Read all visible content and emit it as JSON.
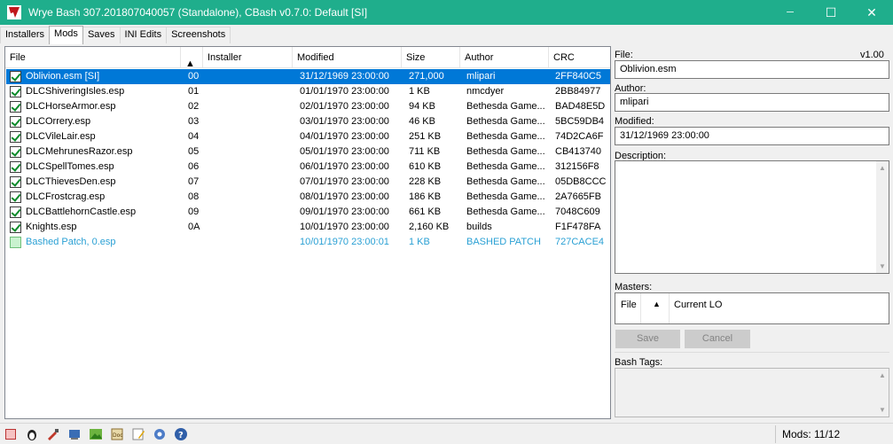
{
  "window": {
    "title": "Wrye Bash 307.201807040057 (Standalone), CBash v0.7.0: Default [SI]",
    "minimize_glyph": "─",
    "maximize_glyph": "☐",
    "close_glyph": "✕",
    "accent_color": "#1fae8c"
  },
  "tabs": [
    {
      "label": "Installers"
    },
    {
      "label": "Mods"
    },
    {
      "label": "Saves"
    },
    {
      "label": "INI Edits"
    },
    {
      "label": "Screenshots"
    }
  ],
  "mods_list": {
    "columns": [
      "File",
      "",
      "Installer",
      "Modified",
      "Size",
      "Author",
      "CRC"
    ],
    "sort_arrow": "▲",
    "rows": [
      {
        "file": "Oblivion.esm [SI]",
        "order": "00",
        "installer": "",
        "modified": "31/12/1969 23:00:00",
        "size": "271,000",
        "author": "mlipari",
        "crc": "2FF840C5",
        "state": "selected"
      },
      {
        "file": "DLCShiveringIsles.esp",
        "order": "01",
        "installer": "",
        "modified": "01/01/1970 23:00:00",
        "size": "1 KB",
        "author": "nmcdyer",
        "crc": "2BB84977",
        "state": "active"
      },
      {
        "file": "DLCHorseArmor.esp",
        "order": "02",
        "installer": "",
        "modified": "02/01/1970 23:00:00",
        "size": "94 KB",
        "author": "Bethesda Game...",
        "crc": "BAD48E5D",
        "state": "active"
      },
      {
        "file": "DLCOrrery.esp",
        "order": "03",
        "installer": "",
        "modified": "03/01/1970 23:00:00",
        "size": "46 KB",
        "author": "Bethesda Game...",
        "crc": "5BC59DB4",
        "state": "active"
      },
      {
        "file": "DLCVileLair.esp",
        "order": "04",
        "installer": "",
        "modified": "04/01/1970 23:00:00",
        "size": "251 KB",
        "author": "Bethesda Game...",
        "crc": "74D2CA6F",
        "state": "active"
      },
      {
        "file": "DLCMehrunesRazor.esp",
        "order": "05",
        "installer": "",
        "modified": "05/01/1970 23:00:00",
        "size": "711 KB",
        "author": "Bethesda Game...",
        "crc": "CB413740",
        "state": "active"
      },
      {
        "file": "DLCSpellTomes.esp",
        "order": "06",
        "installer": "",
        "modified": "06/01/1970 23:00:00",
        "size": "610 KB",
        "author": "Bethesda Game...",
        "crc": "312156F8",
        "state": "active"
      },
      {
        "file": "DLCThievesDen.esp",
        "order": "07",
        "installer": "",
        "modified": "07/01/1970 23:00:00",
        "size": "228 KB",
        "author": "Bethesda Game...",
        "crc": "05DB8CCC",
        "state": "active"
      },
      {
        "file": "DLCFrostcrag.esp",
        "order": "08",
        "installer": "",
        "modified": "08/01/1970 23:00:00",
        "size": "186 KB",
        "author": "Bethesda Game...",
        "crc": "2A7665FB",
        "state": "active"
      },
      {
        "file": "DLCBattlehornCastle.esp",
        "order": "09",
        "installer": "",
        "modified": "09/01/1970 23:00:00",
        "size": "661 KB",
        "author": "Bethesda Game...",
        "crc": "7048C609",
        "state": "active"
      },
      {
        "file": "Knights.esp",
        "order": "0A",
        "installer": "",
        "modified": "10/01/1970 23:00:00",
        "size": "2,160 KB",
        "author": "builds",
        "crc": "F1F478FA",
        "state": "active"
      },
      {
        "file": "Bashed Patch, 0.esp",
        "order": "",
        "installer": "",
        "modified": "10/01/1970 23:00:01",
        "size": "1 KB",
        "author": "BASHED PATCH",
        "crc": "727CACE4",
        "state": "bashed"
      }
    ]
  },
  "details": {
    "file_label": "File:",
    "version": "v1.00",
    "file_value": "Oblivion.esm",
    "author_label": "Author:",
    "author_value": "mlipari",
    "modified_label": "Modified:",
    "modified_value": "31/12/1969 23:00:00",
    "description_label": "Description:",
    "masters_label": "Masters:",
    "masters_columns": [
      "File",
      "▲",
      "Current LO"
    ],
    "save_label": "Save",
    "cancel_label": "Cancel",
    "bash_tags_label": "Bash Tags:"
  },
  "status": {
    "mods_count": "Mods: 11/12",
    "icons": [
      "stop-icon",
      "penguin-icon",
      "tool-icon",
      "settings-tool-icon",
      "image-icon",
      "doc-icon",
      "notepad-icon",
      "gear-icon",
      "help-icon"
    ]
  },
  "colors": {
    "selection": "#0078d7",
    "bashed_text": "#2aa0d4"
  }
}
